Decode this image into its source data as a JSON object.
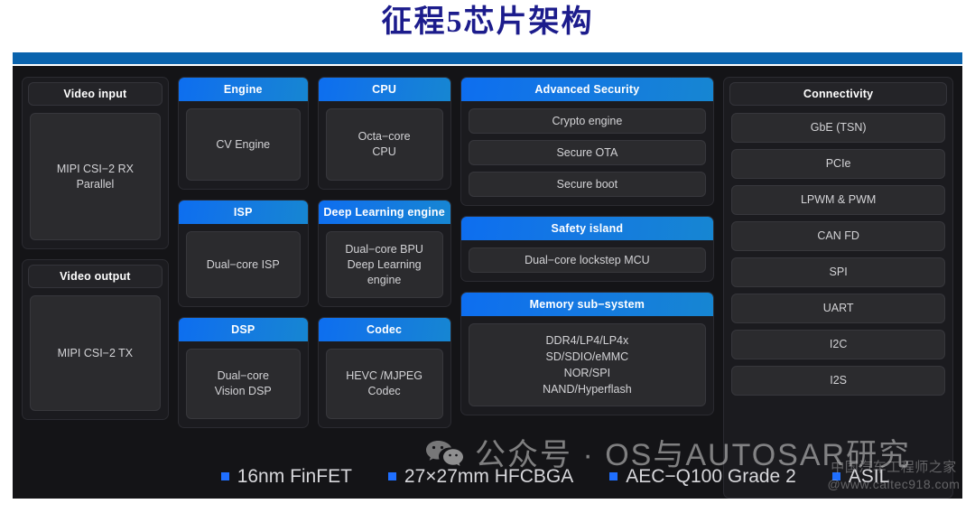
{
  "title": "征程5芯片架构",
  "accent": {
    "title_color": "#1c1c8c",
    "rule_color": "#0a63ad",
    "header_blue_start": "#0d6ef0",
    "header_blue_end": "#1686d2",
    "bullet_color": "#1f6fff",
    "board_bg": "#141417"
  },
  "columns": {
    "video": {
      "groups": [
        {
          "header": "Video input",
          "style": "dark",
          "cells": [
            "MIPI CSI−2 RX\nParallel"
          ]
        },
        {
          "header": "Video output",
          "style": "dark",
          "cells": [
            "MIPI CSI−2 TX"
          ]
        }
      ]
    },
    "engine": {
      "groups": [
        {
          "header": "Engine",
          "style": "blue",
          "cells": [
            "CV Engine"
          ]
        },
        {
          "header": "ISP",
          "style": "blue",
          "cells": [
            "Dual−core ISP"
          ]
        },
        {
          "header": "DSP",
          "style": "blue",
          "cells": [
            "Dual−core\nVision DSP"
          ]
        }
      ]
    },
    "cpu": {
      "groups": [
        {
          "header": "CPU",
          "style": "blue",
          "cells": [
            "Octa−core\nCPU"
          ]
        },
        {
          "header": "Deep Learning engine",
          "style": "blue",
          "cells": [
            "Dual−core BPU\nDeep Learning\nengine"
          ]
        },
        {
          "header": "Codec",
          "style": "blue",
          "cells": [
            "HEVC /MJPEG\nCodec"
          ]
        }
      ]
    },
    "security": {
      "groups": [
        {
          "header": "Advanced Security",
          "style": "blue",
          "cells": [
            "Crypto engine",
            "Secure OTA",
            "Secure boot"
          ]
        },
        {
          "header": "Safety island",
          "style": "blue",
          "cells": [
            "Dual−core lockstep MCU"
          ]
        },
        {
          "header": "Memory sub−system",
          "style": "blue",
          "cells": [
            "DDR4/LP4/LP4x\nSD/SDIO/eMMC\nNOR/SPI\nNAND/Hyperflash"
          ]
        }
      ]
    },
    "connectivity": {
      "header": "Connectivity",
      "header_style": "dark",
      "items": [
        "GbE (TSN)",
        "PCIe",
        "LPWM & PWM",
        "CAN FD",
        "SPI",
        "UART",
        "I2C",
        "I2S"
      ]
    }
  },
  "footer": {
    "bullets": [
      "16nm FinFET",
      "27×27mm HFCBGA",
      "AEC−Q100 Grade 2",
      "ASIL"
    ]
  },
  "watermarks": {
    "main": "公众号 · OS与AUTOSAR研究",
    "sub_line1": "中国汽车工程师之家",
    "sub_line2": "@www.caitec918.com"
  }
}
